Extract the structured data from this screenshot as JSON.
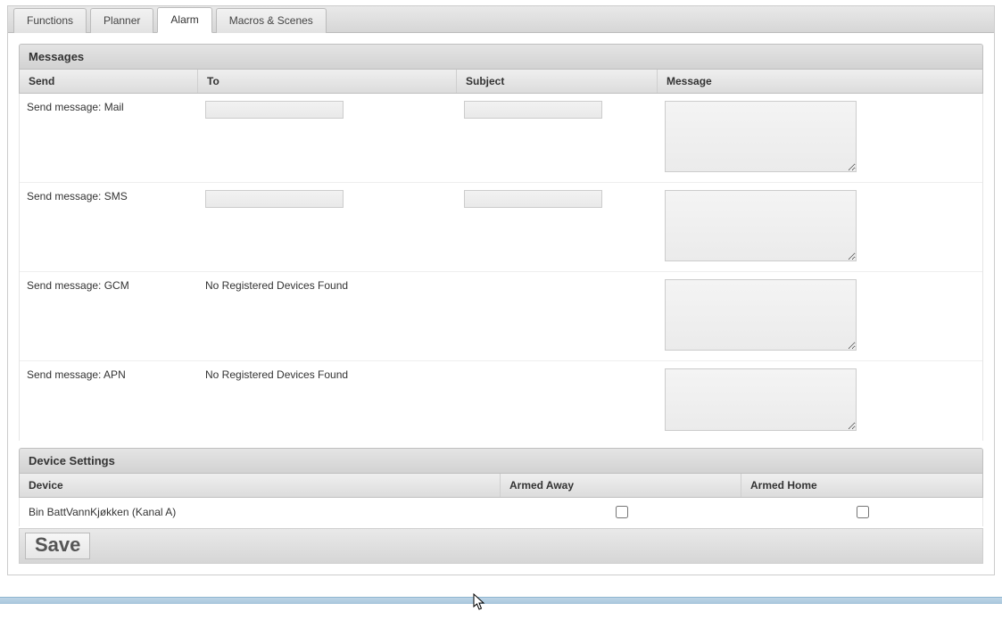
{
  "tabs": {
    "functions": "Functions",
    "planner": "Planner",
    "alarm": "Alarm",
    "macros": "Macros & Scenes"
  },
  "messages": {
    "section_title": "Messages",
    "headers": {
      "send": "Send",
      "to": "To",
      "subject": "Subject",
      "message": "Message"
    },
    "rows": {
      "mail": {
        "label": "Send message: Mail"
      },
      "sms": {
        "label": "Send message: SMS"
      },
      "gcm": {
        "label": "Send message: GCM",
        "no_devices": "No Registered Devices Found"
      },
      "apn": {
        "label": "Send message: APN",
        "no_devices": "No Registered Devices Found"
      }
    }
  },
  "device_settings": {
    "section_title": "Device Settings",
    "headers": {
      "device": "Device",
      "armed_away": "Armed Away",
      "armed_home": "Armed Home"
    },
    "rows": [
      {
        "name": "Bin BattVannKjøkken (Kanal A)",
        "armed_away": false,
        "armed_home": false
      }
    ]
  },
  "buttons": {
    "save": "Save"
  }
}
